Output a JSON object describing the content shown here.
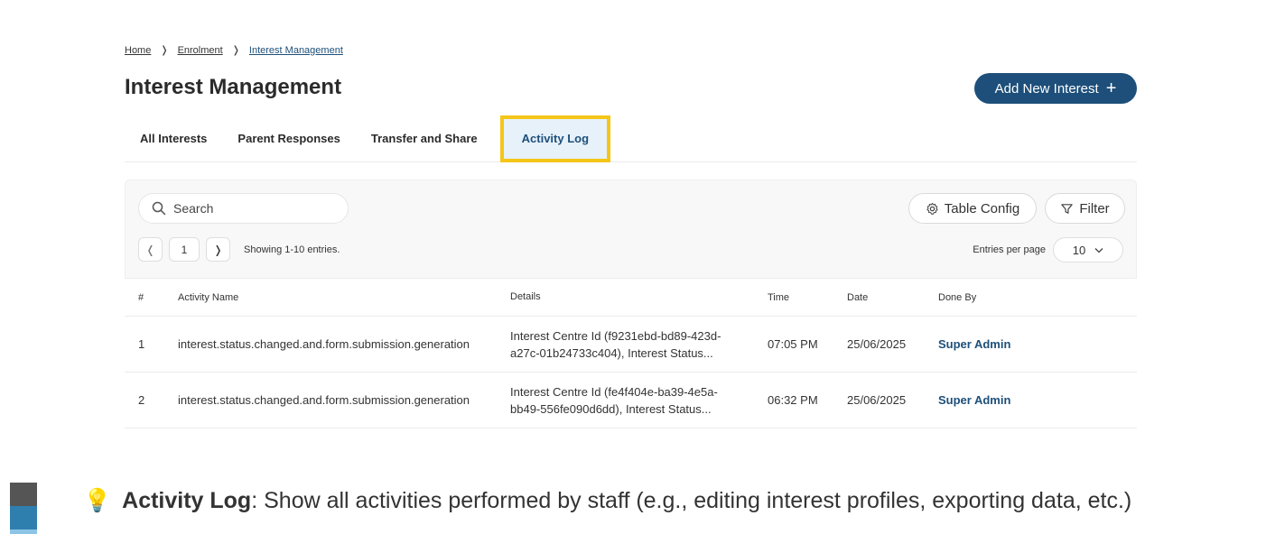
{
  "breadcrumb": {
    "home": "Home",
    "enrolment": "Enrolment",
    "current": "Interest Management",
    "separator": "❭"
  },
  "page": {
    "title": "Interest Management"
  },
  "actions": {
    "add_label": "Add New Interest",
    "add_icon": "+"
  },
  "tabs": [
    {
      "label": "All Interests"
    },
    {
      "label": "Parent Responses"
    },
    {
      "label": "Transfer and Share"
    },
    {
      "label": "Activity Log",
      "active": true
    }
  ],
  "toolbar": {
    "search_placeholder": "Search",
    "table_config_label": "Table Config",
    "filter_label": "Filter",
    "page_number": "1",
    "showing": "Showing 1-10 entries.",
    "entries_per_page_label": "Entries per page",
    "entries_per_page_value": "10"
  },
  "table": {
    "headers": [
      "#",
      "Activity Name",
      "Details",
      "Time",
      "Date",
      "Done By"
    ],
    "rows": [
      {
        "index": "1",
        "activity": "interest.status.changed.and.form.submission.generation",
        "details_line1": "Interest Centre Id (f9231ebd-bd89-423d-",
        "details_line2": "a27c-01b24733c404), Interest Status...",
        "time": "07:05 PM",
        "date": "25/06/2025",
        "done_by": "Super Admin"
      },
      {
        "index": "2",
        "activity": "interest.status.changed.and.form.submission.generation",
        "details_line1": "Interest Centre Id (fe4f404e-ba39-4e5a-",
        "details_line2": "bb49-556fe090d6dd), Interest Status...",
        "time": "06:32 PM",
        "date": "25/06/2025",
        "done_by": "Super Admin"
      }
    ]
  },
  "note": {
    "icon": "💡",
    "title": "Activity Log",
    "text": ": Show all activities performed by staff (e.g., editing interest profiles, exporting data, etc.)"
  },
  "colors": {
    "primary": "#1d4f7a",
    "highlight": "#f5c518",
    "tab_active_bg": "#e7f1fa"
  }
}
